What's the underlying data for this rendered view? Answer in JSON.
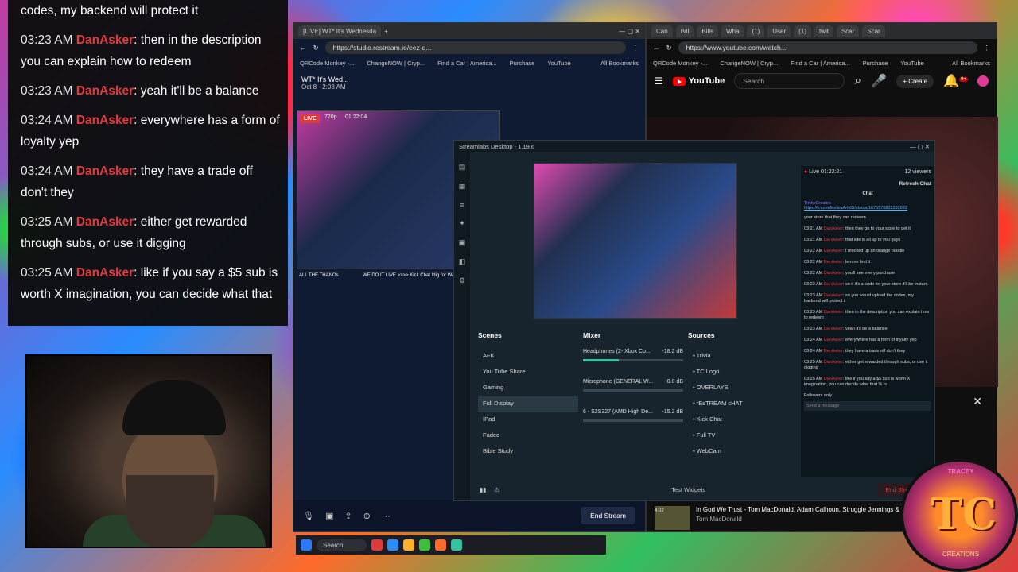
{
  "chat_overlay": {
    "messages": [
      {
        "time": "",
        "user": "",
        "text": "codes, my backend will protect it"
      },
      {
        "time": "03:23 AM",
        "user": "DanAsker",
        "text": ": then in the description you can explain how to redeem"
      },
      {
        "time": "03:23 AM",
        "user": "DanAsker",
        "text": ": yeah it'll be a balance"
      },
      {
        "time": "03:24 AM",
        "user": "DanAsker",
        "text": ": everywhere has a form of loyalty yep"
      },
      {
        "time": "03:24 AM",
        "user": "DanAsker",
        "text": ": they have a trade off don't they"
      },
      {
        "time": "03:25 AM",
        "user": "DanAsker",
        "text": ": either get rewarded through subs, or use it digging"
      },
      {
        "time": "03:25 AM",
        "user": "DanAsker",
        "text": ": like if you say a $5 sub is worth X imagination, you can decide what that"
      }
    ]
  },
  "restream_browser": {
    "tabs": [
      "[LIVE] WT* It's Wednesda"
    ],
    "url": "https://studio.restream.io/eez-q...",
    "bookmarks": [
      "QRCode Monkey -...",
      "ChangeNOW | Cryp...",
      "Find a Car | America...",
      "Purchase",
      "YouTube"
    ],
    "all_bookmarks": "All Bookmarks",
    "stream_title": "WT* It's Wed...",
    "stream_date": "Oct 8 · 2:08 AM",
    "live_label": "LIVE",
    "resolution": "720p",
    "timer": "01:22:04",
    "ticker_left": "ALL THE THANOs",
    "ticker_right": "WE DO IT LIVE >>>> Kick Chat !dig for WAX N",
    "end_stream": "End Stream"
  },
  "youtube_browser": {
    "tabs": [
      "Can",
      "Bill",
      "Bills",
      "Wha",
      "(1)",
      "User",
      "(1)",
      "twit",
      "Scar",
      "Scar"
    ],
    "url": "https://www.youtube.com/watch...",
    "bookmarks": [
      "QRCode Monkey -...",
      "ChangeNOW | Cryp...",
      "Find a Car | America...",
      "Purchase",
      "YouTube"
    ],
    "all_bookmarks": "All Bookmarks",
    "logo": "YouTube",
    "search_placeholder": "Search",
    "create_label": "Create",
    "notif_count": "9+",
    "now_playing_title": "In God We Trust - Tom MacDonald, Adam Calhoun, Struggle Jennings & Nova Rockafe",
    "now_playing_artist": "Tom MacDonald",
    "now_playing_time": "4:02"
  },
  "streamlabs": {
    "title": "Streamlabs Desktop - 1.19.6",
    "live_time": "Live 01:22:21",
    "viewers": "12 viewers",
    "refresh_chat": "Refresh Chat",
    "chat_header": "Chat",
    "chat_user": "TrickyCreates",
    "chat_link": "https://x.com/MelicaArtXD/status/1675576822292022",
    "chat_lines": [
      {
        "time": "",
        "user": "",
        "text": "your store that they can redeem"
      },
      {
        "time": "03:21 AM",
        "user": "DanAsker",
        "text": ": then they go to your store to get it"
      },
      {
        "time": "03:21 AM",
        "user": "DanAsker",
        "text": ": that site is all up to you guys"
      },
      {
        "time": "03:22 AM",
        "user": "DanAsker",
        "text": ": I mocked up an orange hoodie"
      },
      {
        "time": "03:22 AM",
        "user": "DanAsker",
        "text": ": lemme find it"
      },
      {
        "time": "03:22 AM",
        "user": "DanAsker",
        "text": ": you'll see every purchase"
      },
      {
        "time": "03:22 AM",
        "user": "DanAsker",
        "text": ": so if it's a code for your store it'll be instant"
      },
      {
        "time": "03:23 AM",
        "user": "DanAsker",
        "text": ": so you would upload the codes, my backend will protect it"
      },
      {
        "time": "03:23 AM",
        "user": "DanAsker",
        "text": ": then in the description you can explain how to redeem"
      },
      {
        "time": "03:23 AM",
        "user": "DanAsker",
        "text": ": yeah it'll be a balance"
      },
      {
        "time": "03:24 AM",
        "user": "DanAsker",
        "text": ": everywhere has a form of loyalty yep"
      },
      {
        "time": "03:24 AM",
        "user": "DanAsker",
        "text": ": they have a trade off don't they"
      },
      {
        "time": "03:25 AM",
        "user": "DanAsker",
        "text": ": either get rewarded through subs, or use it digging"
      },
      {
        "time": "03:25 AM",
        "user": "DanAsker",
        "text": ": like if you say a $5 sub is worth X imagination, you can decide what that % is"
      }
    ],
    "followers_only": "Followers only",
    "send_placeholder": "Send a message",
    "scenes_title": "Scenes",
    "scenes": [
      "AFK",
      "You Tube Share",
      "Gaming",
      "Full Display",
      "IPad",
      "Faded",
      "Bible Study"
    ],
    "selected_scene": "Full Display",
    "mixer_title": "Mixer",
    "mixer": [
      {
        "name": "Headphones (2- Xbox Co...",
        "db": "-18.2 dB",
        "level": 0.36
      },
      {
        "name": "Microphone (GENERAL W...",
        "db": "0.0 dB",
        "level": 0.0
      },
      {
        "name": "6 - S2S327 (AMD High De...",
        "db": "-15.2 dB",
        "level": 0.0
      }
    ],
    "sources_title": "Sources",
    "sources": [
      "Trivia",
      "TC Logo",
      "OVERLAYS",
      "rEsTREAM cHAT",
      "Kick Chat",
      "Full TV",
      "WebCam"
    ],
    "test_widgets": "Test Widgets",
    "end_stream": "End Stream"
  },
  "taskbar": {
    "search": "Search"
  },
  "logo": {
    "brand": "TRACEY",
    "letters": "TC",
    "sub": "CREATIONS"
  },
  "colors": {
    "username": "#e23a3a",
    "accent": "#31c3a2"
  }
}
